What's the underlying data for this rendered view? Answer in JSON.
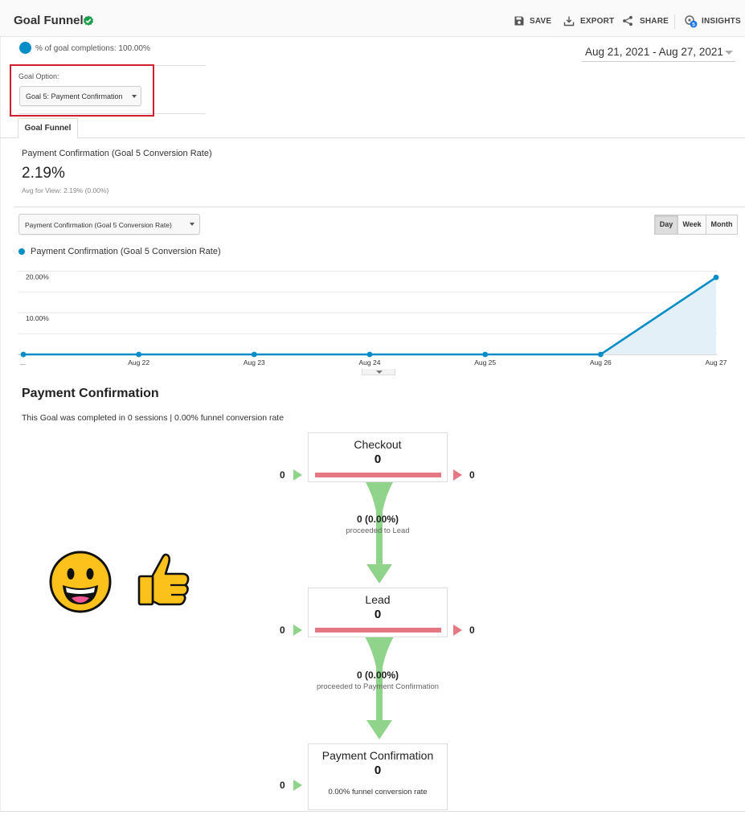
{
  "header": {
    "title": "Goal Funnel",
    "save": "SAVE",
    "export": "EXPORT",
    "share": "SHARE",
    "insights": "INSIGHTS",
    "insights_badge": "5"
  },
  "goal_completions": "% of goal completions: 100.00%",
  "date_range": "Aug 21, 2021 - Aug 27, 2021",
  "goal_option": {
    "label": "Goal Option:",
    "selected": "Goal 5: Payment Confirmation"
  },
  "tab": "Goal Funnel",
  "metric": {
    "name": "Payment Confirmation (Goal 5 Conversion Rate)",
    "value": "2.19%",
    "avg": "Avg for View: 2.19% (0.00%)"
  },
  "metric_select": "Payment Confirmation (Goal 5 Conversion Rate)",
  "granularity": {
    "day": "Day",
    "week": "Week",
    "month": "Month",
    "active": "Day"
  },
  "colors": {
    "series": "#058dc7",
    "dropoff": "#e57883",
    "entrance": "#8fd48a",
    "highlight": "#d0202e"
  },
  "chart_data": {
    "type": "area",
    "legend": "Payment Confirmation (Goal 5 Conversion Rate)",
    "legend_position": "top-left",
    "x": [
      "...",
      "Aug 22",
      "Aug 23",
      "Aug 24",
      "Aug 25",
      "Aug 26",
      "Aug 27"
    ],
    "series": [
      {
        "name": "Payment Confirmation (Goal 5 Conversion Rate)",
        "values": [
          0,
          0,
          0,
          0,
          0,
          0,
          18.5
        ]
      }
    ],
    "yticks": [
      "10.00%",
      "20.00%"
    ],
    "ylim": [
      0,
      22
    ],
    "grid": true
  },
  "funnel": {
    "title": "Payment Confirmation",
    "summary": "This Goal was completed in 0 sessions | 0.00% funnel conversion rate",
    "steps": [
      {
        "name": "Checkout",
        "count": "0",
        "entrances": "0",
        "exits": "0"
      },
      {
        "name": "Lead",
        "count": "0",
        "entrances": "0",
        "exits": "0"
      },
      {
        "name": "Payment Confirmation",
        "count": "0",
        "entrances": "0",
        "rate": "0.00% funnel conversion rate"
      }
    ],
    "flows": [
      {
        "pct": "0 (0.00%)",
        "label": "proceeded to Lead"
      },
      {
        "pct": "0 (0.00%)",
        "label": "proceeded to Payment Confirmation"
      }
    ]
  },
  "emoji": [
    "grinning-face",
    "thumbs-up"
  ]
}
